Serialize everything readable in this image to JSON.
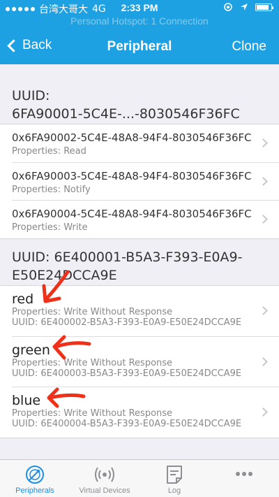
{
  "status_bar": {
    "carrier": "台湾大哥大",
    "network": "4G",
    "time": "2:33 PM",
    "hotspot": "Personal Hotspot: 1 Connection"
  },
  "nav": {
    "back_label": "Back",
    "title": "Peripheral",
    "clone_label": "Clone"
  },
  "services": [
    {
      "header": "UUID:\n6FA90001-5C4E-...-8030546F36FC",
      "characteristics": [
        {
          "uuid": "0x6FA90002-5C4E-48A8-94F4-8030546F36FC",
          "properties": "Properties: Read"
        },
        {
          "uuid": "0x6FA90003-5C4E-48A8-94F4-8030546F36FC",
          "properties": "Properties: Notify"
        },
        {
          "uuid": "0x6FA90004-5C4E-48A8-94F4-8030546F36FC",
          "properties": "Properties: Write"
        }
      ]
    },
    {
      "header": "UUID: 6E400001-B5A3-F393-E0A9-\nE50E24DCCA9E",
      "characteristics": [
        {
          "name": "red",
          "properties": "Properties: Write Without Response",
          "uuid": "UUID: 6E400002-B5A3-F393-E0A9-E50E24DCCA9E"
        },
        {
          "name": "green",
          "properties": "Properties: Write Without Response",
          "uuid": "UUID: 6E400003-B5A3-F393-E0A9-E50E24DCCA9E"
        },
        {
          "name": "blue",
          "properties": "Properties: Write Without Response",
          "uuid": "UUID: 6E400004-B5A3-F393-E0A9-E50E24DCCA9E"
        }
      ]
    }
  ],
  "tabs": [
    {
      "label": "Peripherals",
      "icon": "peripherals-radar-icon",
      "active": true
    },
    {
      "label": "Virtual Devices",
      "icon": "broadcast-icon",
      "active": false
    },
    {
      "label": "Log",
      "icon": "log-note-icon",
      "active": false
    },
    {
      "label": "More",
      "icon": "more-ellipsis-icon",
      "active": false
    }
  ],
  "colors": {
    "nav_blue": "#1da1e3",
    "annotation_red": "#f0311a",
    "tab_active": "#1d8fe0"
  }
}
